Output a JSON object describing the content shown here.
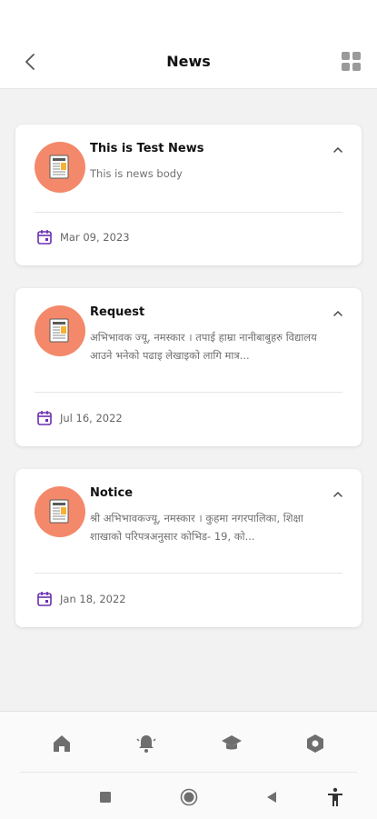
{
  "header": {
    "title": "News"
  },
  "colors": {
    "accent": "#f3896a",
    "calendar": "#6a2fb0",
    "status_dot": "#f39c1e"
  },
  "news": [
    {
      "title": "This is Test News",
      "body": "This is news body",
      "date": "Mar 09, 2023"
    },
    {
      "title": "Request",
      "body": "अभिभावक ज्यू, नमस्कार । तपाई हाम्रा नानीबाबुहरु विद्यालय आउने भनेको पढाइ लेखाइको लागि मात्र...",
      "date": "Jul 16, 2022"
    },
    {
      "title": "Notice",
      "body": "श्री अभिभावकज्यू, नमस्कार । कुहमा नगरपालिका, शिक्षा शाखाको परिपत्रअनुसार कोभिड- 19, को...",
      "date": "Jan 18, 2022"
    }
  ],
  "bottom_nav": {
    "items": [
      "home-icon",
      "notifications-icon",
      "academics-icon",
      "settings-icon"
    ]
  },
  "system_nav": {
    "items": [
      "recents-icon",
      "home-circle-icon",
      "back-triangle-icon",
      "accessibility-icon"
    ]
  }
}
